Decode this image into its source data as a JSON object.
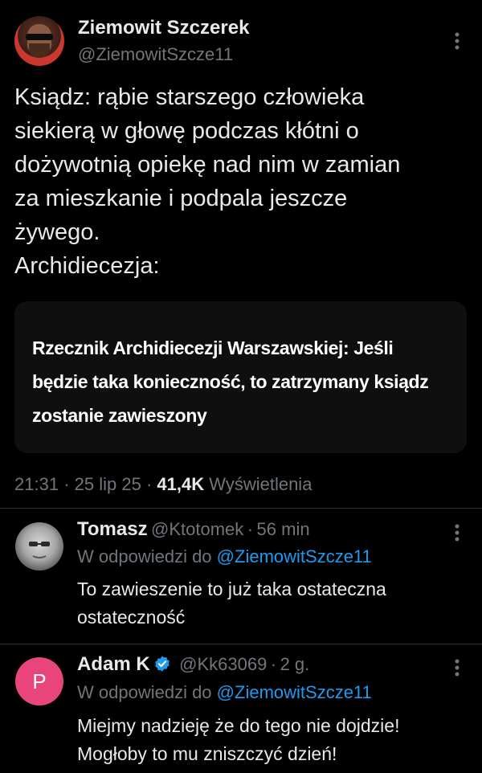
{
  "tweet": {
    "author_name": "Ziemowit Szczerek",
    "author_handle": "@ZiemowitSzcze11",
    "more_icon": "more-vertical-icon",
    "text_lines": [
      "Ksiądz: rąbie starszego człowieka",
      "siekierą w głowę podczas kłótni o",
      "dożywotnią opiekę nad nim w zamian",
      "za mieszkanie i podpala jeszcze",
      "żywego.",
      "Archidiecezja:"
    ],
    "card_text": "Rzecznik Archidiecezji Warszawskiej: Jeśli będzie taka konieczność, to zatrzymany ksiądz zostanie zawieszony",
    "time": "21:31",
    "date": "25 lip 25",
    "views_count": "41,4K",
    "views_label": "Wyświetlenia"
  },
  "replies": [
    {
      "name": "Tomasz",
      "handle": "@Ktotomek",
      "time": "56 min",
      "in_reply_prefix": "W odpowiedzi do",
      "in_reply_handle": "@ZiemowitSzcze11",
      "text_lines": [
        "To zawieszenie to już taka ostateczna",
        "ostateczność"
      ]
    },
    {
      "name": "Adam K",
      "handle": "@Kk63069",
      "time": "2 g.",
      "avatar_letter": "P",
      "in_reply_prefix": "W odpowiedzi do",
      "in_reply_handle": "@ZiemowitSzcze11",
      "text_lines": [
        "Miejmy nadzieję że do tego nie dojdzie!",
        "Mogłoby to mu zniszczyć dzień!"
      ]
    }
  ],
  "colors": {
    "background": "#000000",
    "text": "#e7e9ea",
    "secondary": "#71767b",
    "link": "#1d9bf0",
    "avatar_p": "#e8457a"
  },
  "separator": "·"
}
